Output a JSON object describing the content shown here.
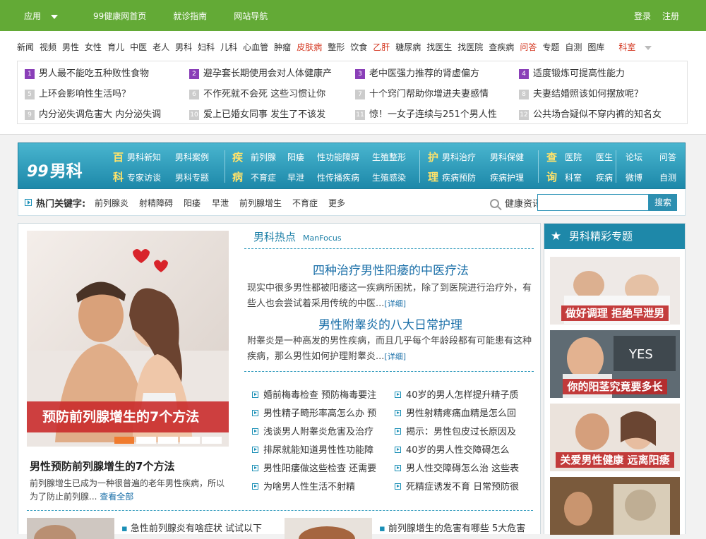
{
  "topbar": {
    "app": "应用",
    "nav": [
      "99健康网首页",
      "就诊指南",
      "网站导航"
    ],
    "login": "登录",
    "register": "注册"
  },
  "channels": [
    {
      "t": "新闻",
      "c": ""
    },
    {
      "t": "视频",
      "c": ""
    },
    {
      "t": "男性",
      "c": ""
    },
    {
      "t": "女性",
      "c": ""
    },
    {
      "t": "育儿",
      "c": ""
    },
    {
      "t": "中医",
      "c": ""
    },
    {
      "t": "老人",
      "c": ""
    },
    {
      "t": "男科",
      "c": ""
    },
    {
      "t": "妇科",
      "c": ""
    },
    {
      "t": "儿科",
      "c": ""
    },
    {
      "t": "心血管",
      "c": ""
    },
    {
      "t": "肿瘤",
      "c": ""
    },
    {
      "t": "皮肤病",
      "c": "red"
    },
    {
      "t": "整形",
      "c": ""
    },
    {
      "t": "饮食",
      "c": ""
    },
    {
      "t": "乙肝",
      "c": "red"
    },
    {
      "t": "糖尿病",
      "c": ""
    },
    {
      "t": "找医生",
      "c": ""
    },
    {
      "t": "找医院",
      "c": ""
    },
    {
      "t": "查疾病",
      "c": ""
    },
    {
      "t": "问答",
      "c": "red"
    },
    {
      "t": "专题",
      "c": ""
    },
    {
      "t": "自测",
      "c": ""
    },
    {
      "t": "图库",
      "c": ""
    }
  ],
  "channel_more": "科室",
  "hotlist": [
    {
      "n": "1",
      "t": "男人最不能吃五种败性食物"
    },
    {
      "n": "2",
      "t": "避孕套长期使用会对人体健康产"
    },
    {
      "n": "3",
      "t": "老中医强力推荐的肾虚偏方"
    },
    {
      "n": "4",
      "t": "适度锻炼可提高性能力"
    },
    {
      "n": "5",
      "t": "上环会影响性生活吗？"
    },
    {
      "n": "6",
      "t": "不作死就不会死 这些习惯让你"
    },
    {
      "n": "7",
      "t": "十个窍门帮助你增进夫妻感情"
    },
    {
      "n": "8",
      "t": "夫妻结婚照该如何摆放呢？"
    },
    {
      "n": "9",
      "t": "内分泌失调危害大 内分泌失调"
    },
    {
      "n": "10",
      "t": "爱上已婚女同事 发生了不该发"
    },
    {
      "n": "11",
      "t": "惊！一女子连续与251个男人性"
    },
    {
      "n": "12",
      "t": "公共场合疑似不穿内裤的知名女"
    }
  ],
  "banner": {
    "logo_num": "99",
    "logo_text": "男科",
    "groups": [
      {
        "tag1": "百",
        "tag2": "科",
        "row1": [
          "男科新知",
          "男科案例"
        ],
        "row2": [
          "专家访谈",
          "男科专题"
        ]
      },
      {
        "tag1": "疾",
        "tag2": "病",
        "row1": [
          "前列腺",
          "阳痿",
          "性功能障碍",
          "生殖整形"
        ],
        "row2": [
          "不育症",
          "早泄",
          "性传播疾病",
          "生殖感染"
        ]
      },
      {
        "tag1": "护",
        "tag2": "理",
        "row1": [
          "男科治疗",
          "男科保健"
        ],
        "row2": [
          "疾病预防",
          "疾病护理"
        ]
      },
      {
        "tag1": "查",
        "tag2": "询",
        "row1": [
          "医院",
          "医生"
        ],
        "row2": [
          "科室",
          "疾病"
        ]
      },
      {
        "tag1": "",
        "tag2": "",
        "row1": [
          "论坛",
          "问答"
        ],
        "row2": [
          "微博",
          "自测"
        ]
      }
    ]
  },
  "keywords": {
    "label": "热门关键字:",
    "items": [
      "前列腺炎",
      "射精障碍",
      "阳痿",
      "早泄",
      "前列腺增生",
      "不育症",
      "更多"
    ]
  },
  "search": {
    "label": "健康资讯:",
    "button": "搜索",
    "placeholder": "",
    "value": ""
  },
  "feature": {
    "slide_caption": "预防前列腺增生的7个方法",
    "title": "男性预防前列腺增生的7个方法",
    "desc": "前列腺增生已成为一种很普遍的老年男性疾病，所以为了防止前列腺...",
    "more": "查看全部"
  },
  "hot": {
    "heading": "男科热点",
    "heading_en": "ManFocus",
    "articles": [
      {
        "title": "四种治疗男性阳痿的中医疗法",
        "desc": "现实中很多男性都被阳痿这一疾病所困扰，除了到医院进行治疗外，有些人也会尝试着采用传统的中医...",
        "more": "[详细]"
      },
      {
        "title": "男性附睾炎的八大日常护理",
        "desc": "附睾炎是一种高发的男性疾病，而且几乎每个年龄段都有可能患有这种疾病，那么男性如何护理附睾炎...",
        "more": "[详细]"
      }
    ],
    "list_left": [
      "婚前梅毒检查 预防梅毒要注",
      "男性精子畸形率高怎么办 预",
      "浅谈男人附睾炎危害及治疗",
      "排尿就能知道男性性功能障",
      "男性阳痿做这些检查 还需要",
      "为啥男人性生活不射精"
    ],
    "list_right": [
      "40岁的男人怎样提升精子质",
      "男性射精疼痛血精是怎么回",
      "揭示：男性包皮过长原因及",
      "40岁的男人性交障碍怎么",
      "男人性交障碍怎么治 这些表",
      "死精症诱发不育 日常预防很"
    ]
  },
  "bottom": [
    "急性前列腺炎有啥症状 试试以下",
    "前列腺增生的危害有哪些 5大危害"
  ],
  "side": {
    "heading": "男科精彩专题",
    "captions": [
      "做好调理 拒绝早泄男",
      "你的阳茎究竟要多长",
      "关爱男性健康 远离阳痿",
      ""
    ]
  }
}
